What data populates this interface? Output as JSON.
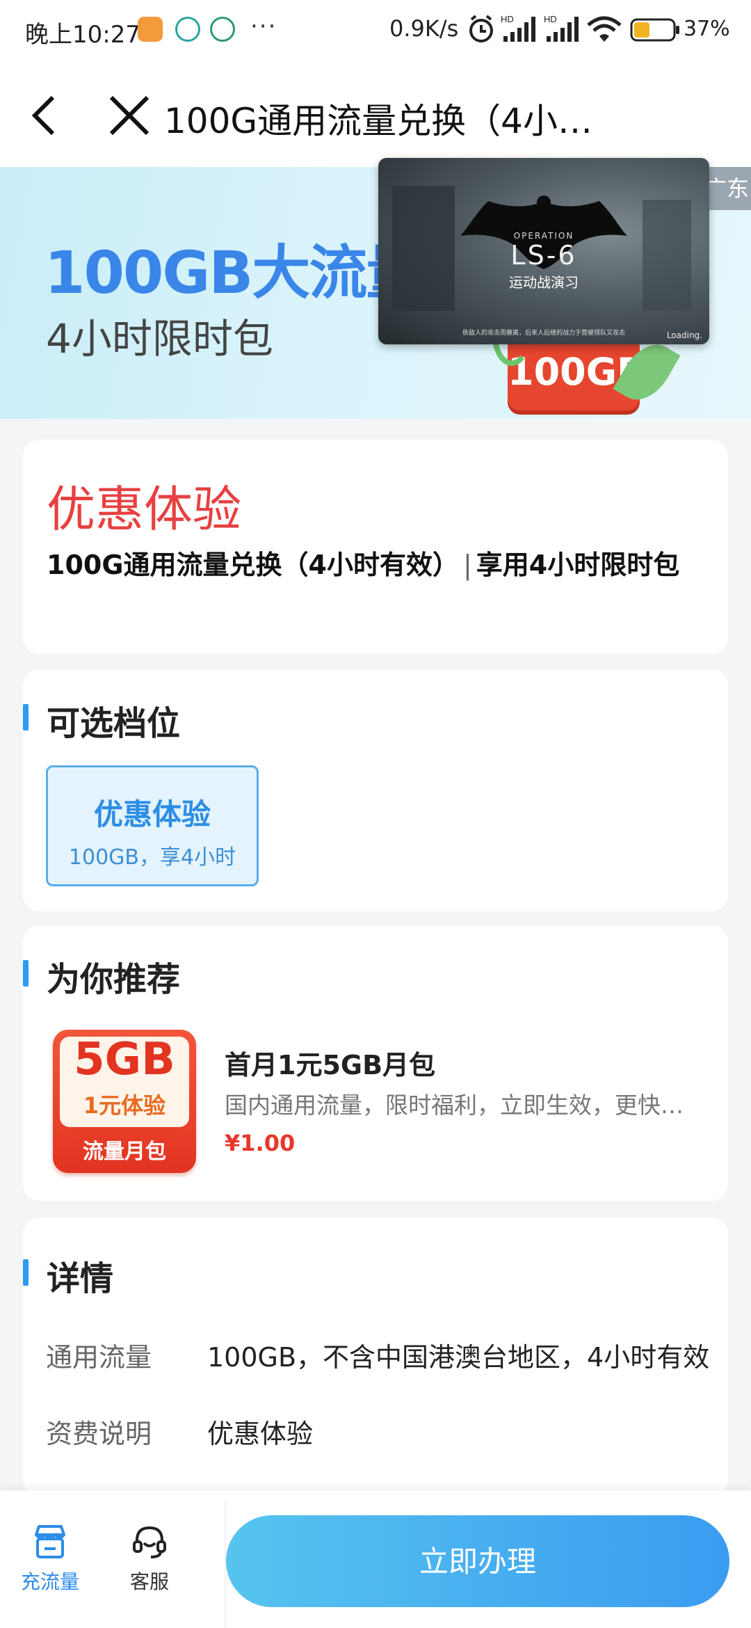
{
  "status_bar": {
    "time": "晚上10:27",
    "dots": "···",
    "speed": "0.9K/s",
    "battery": "37%"
  },
  "nav": {
    "title": "100G通用流量兑换（4小…"
  },
  "banner": {
    "title": "100GB大流量",
    "subtitle": "4小时限时包",
    "region": "广东",
    "chip": "100GB"
  },
  "video": {
    "operation": "OPERATION",
    "title": "LS-6",
    "subtitle": "运动战演习",
    "caption": "依敌人的攻击而撤离，后来人后继的战力于营被领队又攻击",
    "loading": "Loading."
  },
  "offer": {
    "title": "优惠体验",
    "name": "100G通用流量兑换（4小时有效）",
    "separator": "|",
    "tagline": "享用4小时限时包"
  },
  "tiers": {
    "section_title": "可选档位",
    "items": [
      {
        "name": "优惠体验",
        "desc": "100GB，享4小时"
      }
    ]
  },
  "recommend": {
    "section_title": "为你推荐",
    "image": {
      "big": "5GB",
      "mid": "1元体验",
      "bottom": "流量月包"
    },
    "name": "首月1元5GB月包",
    "desc": "国内通用流量，限时福利，立即生效，更快…",
    "price": "¥1.00"
  },
  "details": {
    "section_title": "详情",
    "rows": [
      {
        "label": "通用流量",
        "value": "100GB，不含中国港澳台地区，4小时有效"
      },
      {
        "label": "资费说明",
        "value": "优惠体验"
      }
    ]
  },
  "bottom_bar": {
    "tab_recharge": "充流量",
    "tab_service": "客服",
    "cta": "立即办理"
  },
  "colors": {
    "accent": "#2c9cf0",
    "offer_red": "#e84040",
    "price_red": "#e8372a",
    "cta_start": "#56c4ef",
    "cta_end": "#3a9cf0"
  }
}
